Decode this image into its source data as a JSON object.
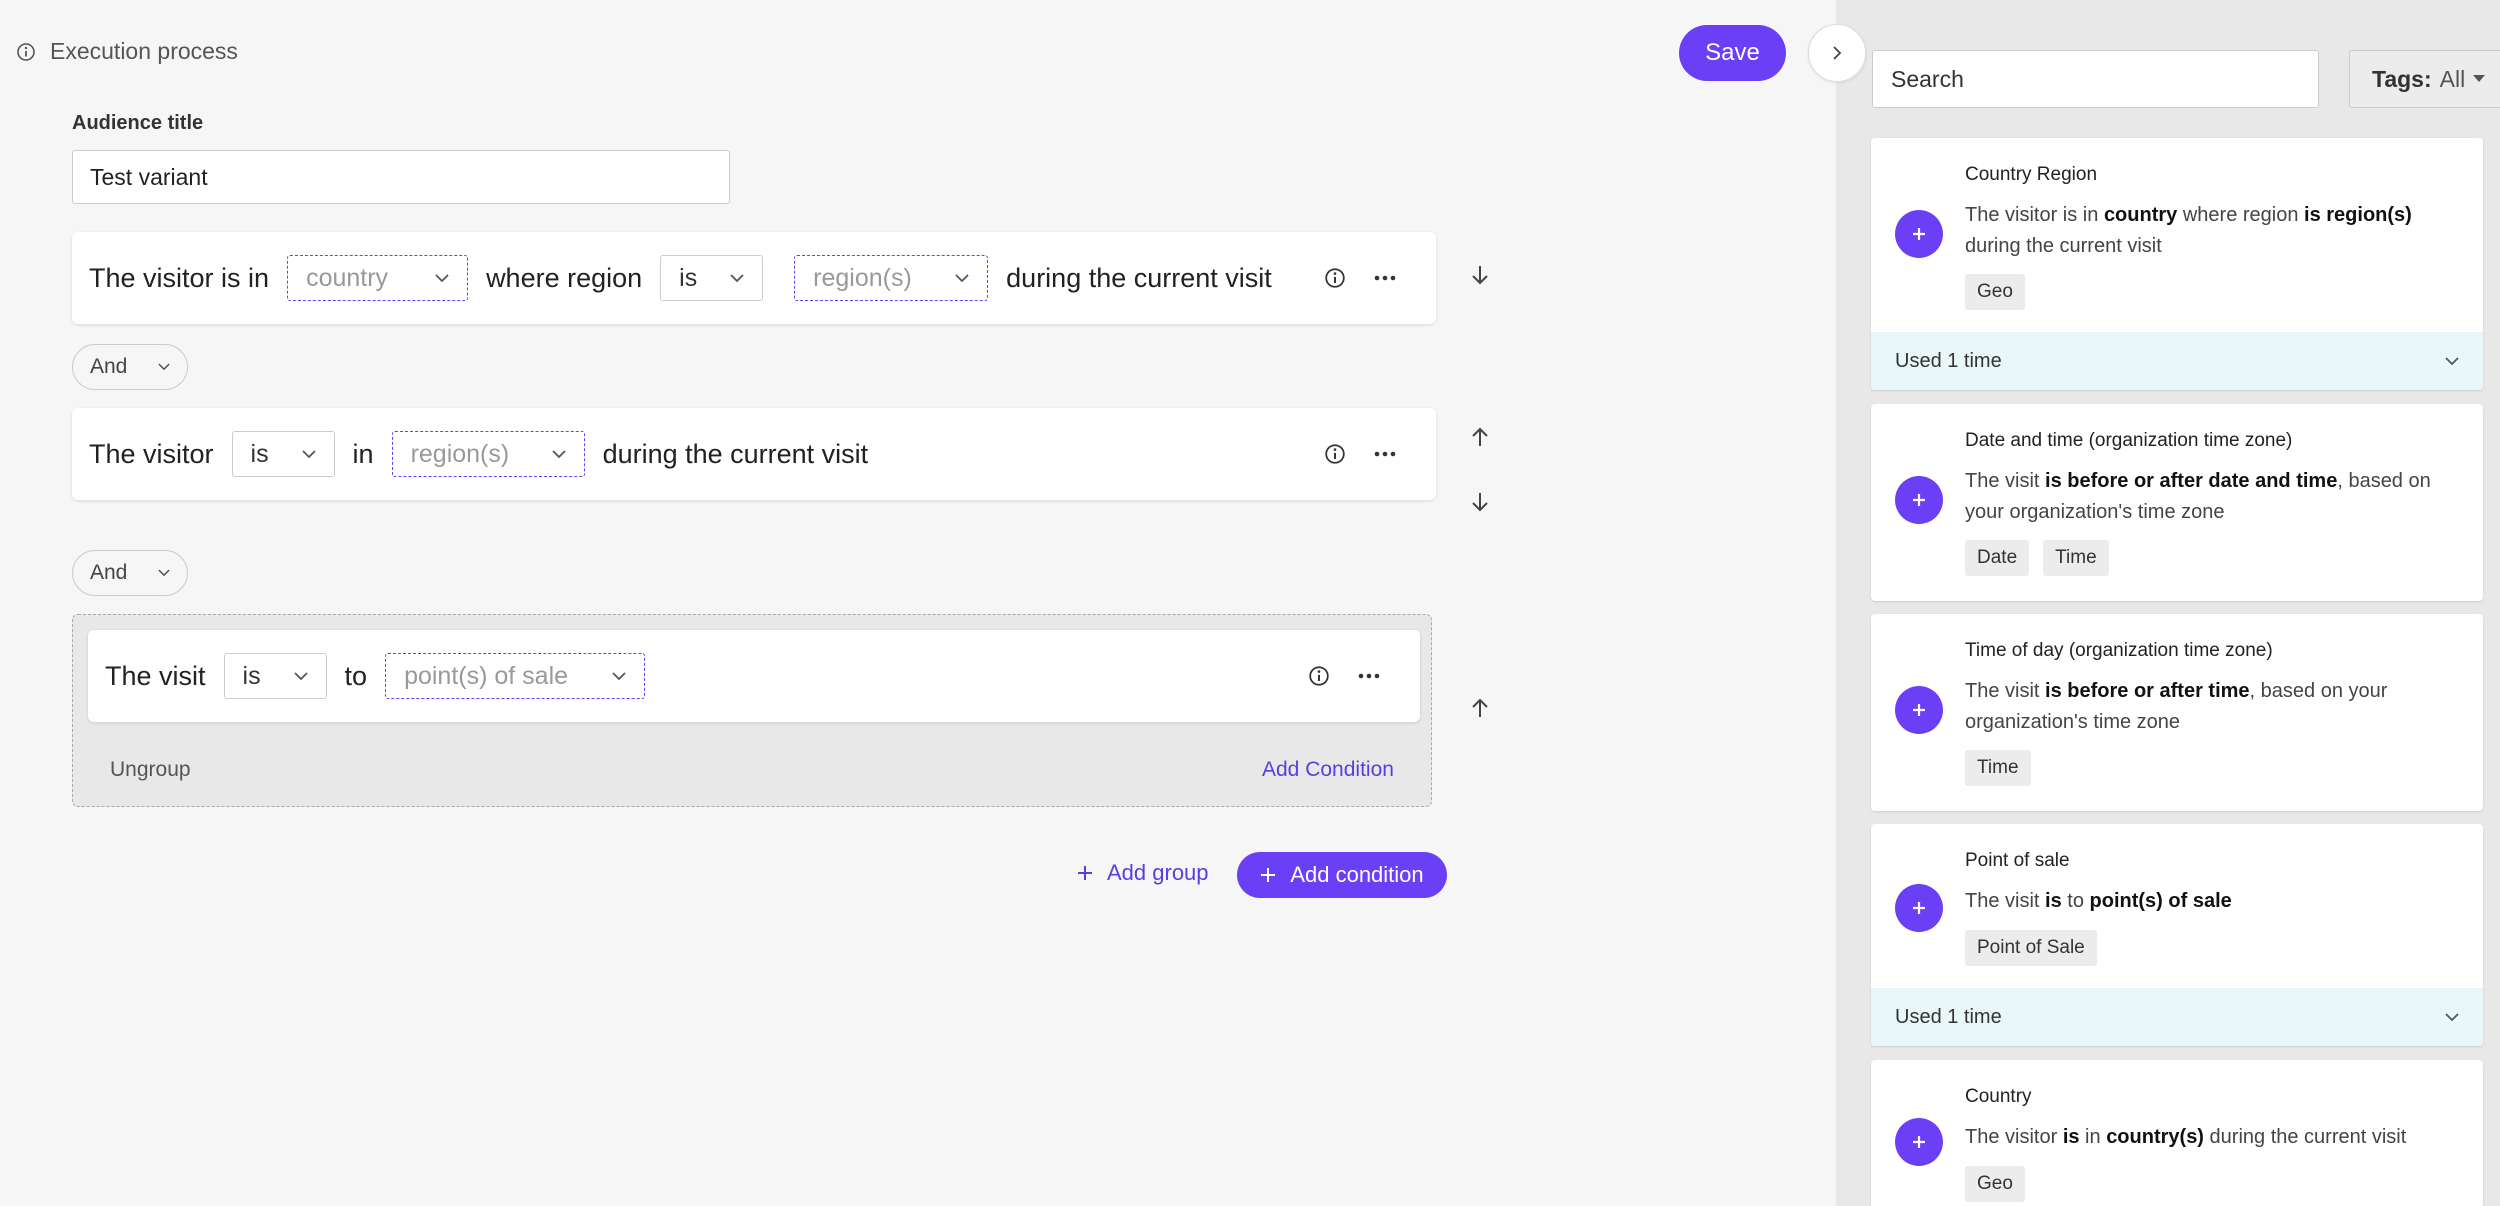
{
  "header": {
    "execution_label": "Execution process",
    "save_label": "Save"
  },
  "audience": {
    "title_label": "Audience title",
    "title_value": "Test variant"
  },
  "conditions": [
    {
      "text1": "The visitor is in",
      "dd1": "country",
      "text2": "where region",
      "dd2": "is",
      "dd3": "region(s)",
      "text3": "during the current visit"
    },
    {
      "text1": "The visitor",
      "dd1": "is",
      "text2": "in",
      "dd2": "region(s)",
      "text3": "during the current visit"
    },
    {
      "text1": "The visit",
      "dd1": "is",
      "text2": "to",
      "dd2": "point(s) of sale"
    }
  ],
  "operators": [
    "And",
    "And"
  ],
  "group": {
    "ungroup_label": "Ungroup",
    "add_condition_label": "Add Condition"
  },
  "actions": {
    "add_group_label": "Add group",
    "add_condition_label": "Add condition"
  },
  "panel": {
    "search_placeholder": "Search",
    "tags_label": "Tags:",
    "tags_value": "All",
    "cards": [
      {
        "title": "Country Region",
        "desc": [
          {
            "t": "The visitor is in "
          },
          {
            "t": "country",
            "b": true
          },
          {
            "t": " where region "
          },
          {
            "t": "is region(s)",
            "b": true
          },
          {
            "t": " during the current visit"
          }
        ],
        "tags": [
          "Geo"
        ],
        "used": "Used 1 time"
      },
      {
        "title": "Date and time (organization time zone)",
        "desc": [
          {
            "t": "The visit "
          },
          {
            "t": "is before or after date and time",
            "b": true
          },
          {
            "t": ", based on your organization's time zone"
          }
        ],
        "tags": [
          "Date",
          "Time"
        ]
      },
      {
        "title": "Time of day (organization time zone)",
        "desc": [
          {
            "t": "The visit "
          },
          {
            "t": "is before or after time",
            "b": true
          },
          {
            "t": ", based on your organization's time zone"
          }
        ],
        "tags": [
          "Time"
        ]
      },
      {
        "title": "Point of sale",
        "desc": [
          {
            "t": "The visit "
          },
          {
            "t": "is",
            "b": true
          },
          {
            "t": " to "
          },
          {
            "t": "point(s) of sale",
            "b": true
          }
        ],
        "tags": [
          "Point of Sale"
        ],
        "used": "Used 1 time"
      },
      {
        "title": "Country",
        "desc": [
          {
            "t": "The visitor "
          },
          {
            "t": "is",
            "b": true
          },
          {
            "t": " in "
          },
          {
            "t": "country(s)",
            "b": true
          },
          {
            "t": " during the current visit"
          }
        ],
        "tags": [
          "Geo"
        ]
      }
    ]
  },
  "colors": {
    "accent": "#6b3ff5",
    "link": "#5b3de0",
    "used_bg": "#eaf7f8"
  }
}
